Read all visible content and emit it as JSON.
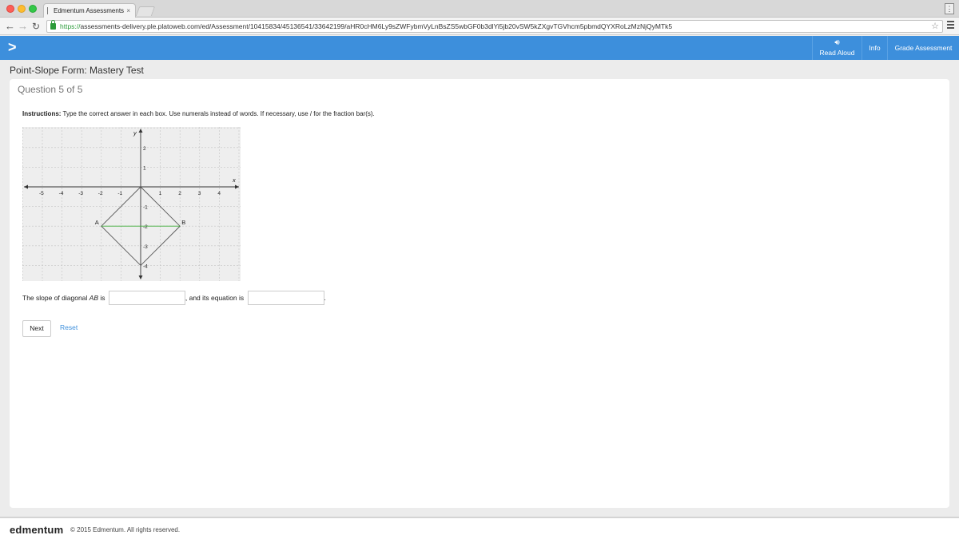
{
  "browser": {
    "tab_title": "Edmentum Assessments",
    "tab_close": "×",
    "url_scheme": "https://",
    "url_rest": "assessments-delivery.ple.platoweb.com/ed/Assessment/10415834/45136541/33642199/aHR0cHM6Ly9sZWFybmVyLnBsZS5wbGF0b3dlYi5jb20vSW5kZXgvTGVhcm5pbmdQYXRoLzMzNjQyMTk5",
    "icons": [
      "back-icon",
      "forward-icon",
      "reload-icon",
      "lock-icon",
      "star-icon",
      "menu-icon"
    ]
  },
  "header": {
    "expand_symbol": ">",
    "read_aloud": "Read Aloud",
    "info": "Info",
    "grade": "Grade Assessment",
    "color": "#3d8fdc"
  },
  "test": {
    "title": "Point-Slope Form: Mastery Test",
    "question_label": "Question 5 of 5"
  },
  "question": {
    "instructions_label": "Instructions:",
    "instructions_text": " Type the correct answer in each box. Use numerals instead of words. If necessary, use / for the fraction bar(s).",
    "prompt_1": "The slope of diagonal ",
    "prompt_ab": "AB",
    "prompt_2": " is",
    "prompt_3": ", and its equation is",
    "prompt_end": ".",
    "slope_value": "",
    "equation_value": ""
  },
  "graph": {
    "x_axis_label": "x",
    "y_axis_label": "y",
    "x_ticks": [
      -5,
      -4,
      -3,
      -2,
      -1,
      1,
      2,
      3,
      4
    ],
    "y_ticks": [
      2,
      1,
      -1,
      -2,
      -3,
      -4
    ],
    "points": [
      {
        "name": "A",
        "x": -2,
        "y": -2
      },
      {
        "name": "B",
        "x": 2,
        "y": -2
      },
      {
        "name": "",
        "x": 0,
        "y": 0
      },
      {
        "name": "",
        "x": 0,
        "y": -4
      }
    ],
    "diagonal_color": "#3aaa35"
  },
  "actions": {
    "next": "Next",
    "reset": "Reset"
  },
  "footer": {
    "logo": "edmentum",
    "copyright": "© 2015 Edmentum. All rights reserved."
  }
}
